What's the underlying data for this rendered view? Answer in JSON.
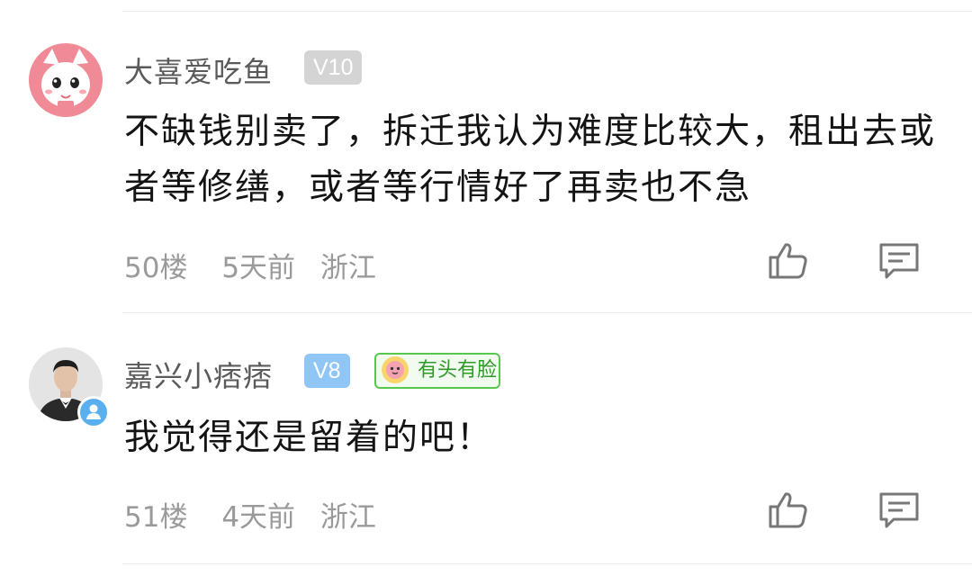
{
  "comments": [
    {
      "username": "大喜爱吃鱼",
      "level": "V10",
      "text": "不缺钱别卖了，拆迁我认为难度比较大，租出去或者等修缮，或者等行情好了再卖也不急",
      "floor": "50楼",
      "time": "5天前",
      "region": "浙江"
    },
    {
      "username": "嘉兴小痞痞",
      "level": "V8",
      "badge": "有头有脸",
      "text": "我觉得还是留着的吧！",
      "floor": "51楼",
      "time": "4天前",
      "region": "浙江"
    }
  ]
}
